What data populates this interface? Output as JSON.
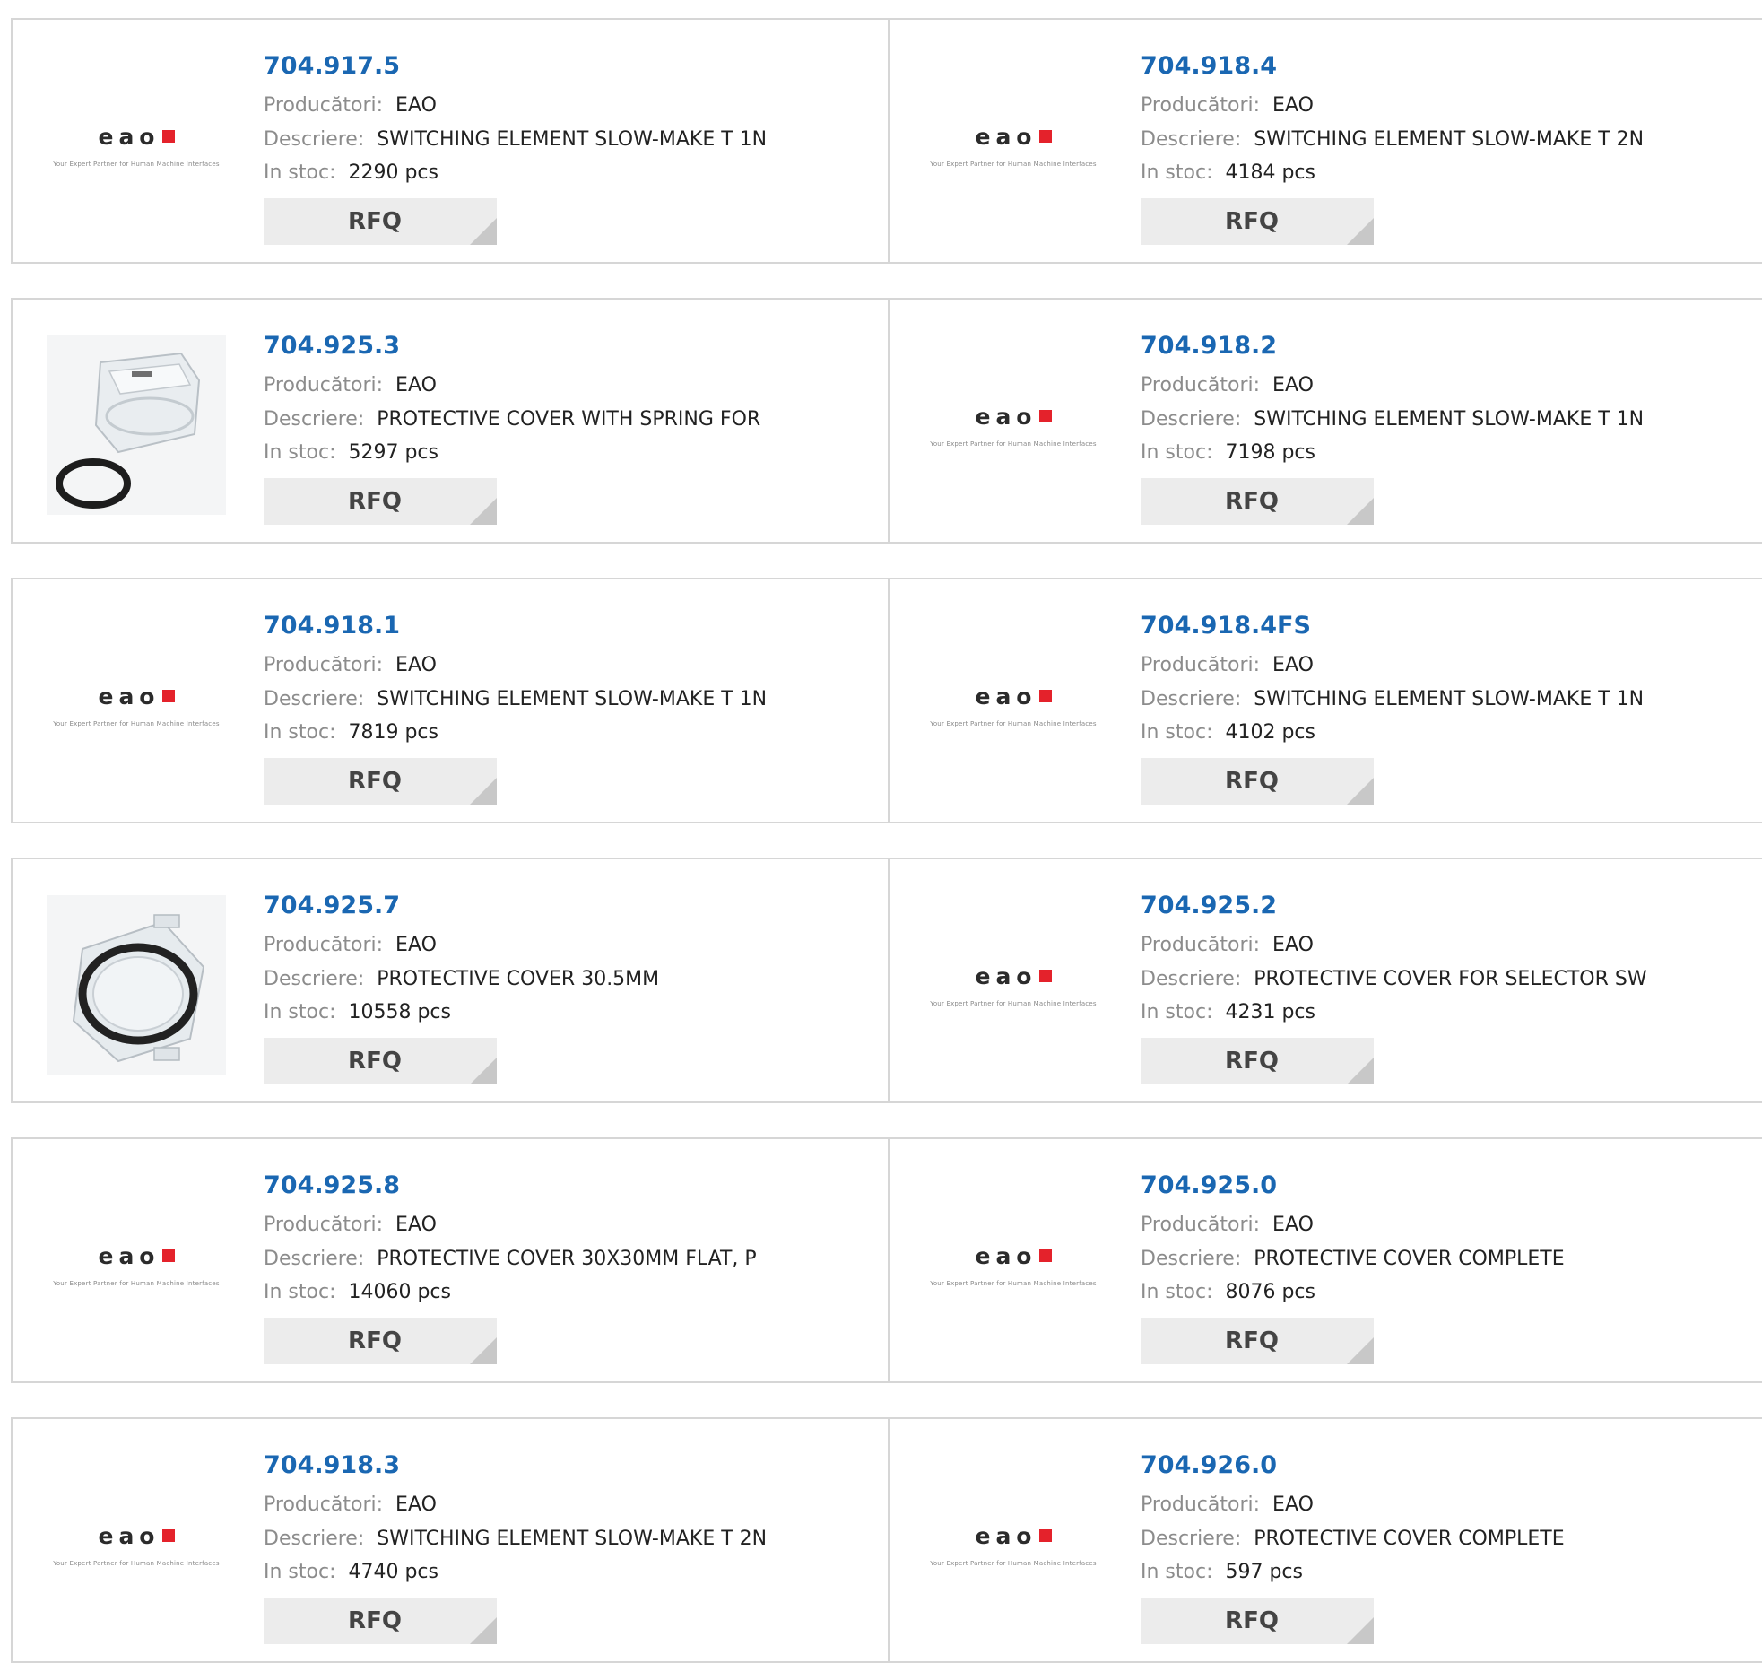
{
  "labels": {
    "manufacturer": "Producători:",
    "description": "Descriere:",
    "stock": "In stoc:",
    "rfq": "RFQ"
  },
  "brand": {
    "logo_text": "eao",
    "tagline": "Your Expert Partner for Human Machine Interfaces",
    "accent_color": "#e4222b"
  },
  "products": [
    {
      "part": "704.917.5",
      "manufacturer": "EAO",
      "description": "SWITCHING ELEMENT SLOW-MAKE T 1N",
      "stock": "2290 pcs",
      "image": "eao-logo"
    },
    {
      "part": "704.918.4",
      "manufacturer": "EAO",
      "description": "SWITCHING ELEMENT SLOW-MAKE T 2N",
      "stock": "4184 pcs",
      "image": "eao-logo"
    },
    {
      "part": "704.925.3",
      "manufacturer": "EAO",
      "description": "PROTECTIVE COVER WITH SPRING FOR",
      "stock": "5297 pcs",
      "image": "protective-cover-spring-photo"
    },
    {
      "part": "704.918.2",
      "manufacturer": "EAO",
      "description": "SWITCHING ELEMENT SLOW-MAKE T 1N",
      "stock": "7198 pcs",
      "image": "eao-logo"
    },
    {
      "part": "704.918.1",
      "manufacturer": "EAO",
      "description": "SWITCHING ELEMENT SLOW-MAKE T 1N",
      "stock": "7819 pcs",
      "image": "eao-logo"
    },
    {
      "part": "704.918.4FS",
      "manufacturer": "EAO",
      "description": "SWITCHING ELEMENT SLOW-MAKE T 1N",
      "stock": "4102 pcs",
      "image": "eao-logo"
    },
    {
      "part": "704.925.7",
      "manufacturer": "EAO",
      "description": "PROTECTIVE COVER 30.5MM",
      "stock": "10558 pcs",
      "image": "protective-cover-ring-photo"
    },
    {
      "part": "704.925.2",
      "manufacturer": "EAO",
      "description": "PROTECTIVE COVER FOR SELECTOR SW",
      "stock": "4231 pcs",
      "image": "eao-logo"
    },
    {
      "part": "704.925.8",
      "manufacturer": "EAO",
      "description": "PROTECTIVE COVER 30X30MM FLAT, P",
      "stock": "14060 pcs",
      "image": "eao-logo"
    },
    {
      "part": "704.925.0",
      "manufacturer": "EAO",
      "description": "PROTECTIVE COVER COMPLETE",
      "stock": "8076 pcs",
      "image": "eao-logo"
    },
    {
      "part": "704.918.3",
      "manufacturer": "EAO",
      "description": "SWITCHING ELEMENT SLOW-MAKE T 2N",
      "stock": "4740 pcs",
      "image": "eao-logo"
    },
    {
      "part": "704.926.0",
      "manufacturer": "EAO",
      "description": "PROTECTIVE COVER COMPLETE",
      "stock": "597 pcs",
      "image": "eao-logo"
    }
  ]
}
